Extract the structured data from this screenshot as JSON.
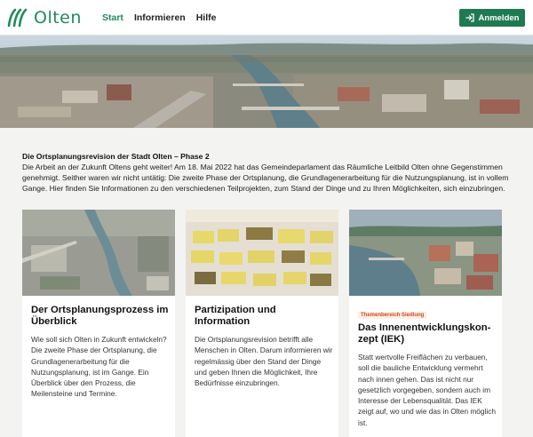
{
  "header": {
    "logo_text": "Olten",
    "nav": [
      {
        "label": "Start",
        "active": true
      },
      {
        "label": "Informieren",
        "active": false
      },
      {
        "label": "Hilfe",
        "active": false
      }
    ],
    "login_label": "Anmelden"
  },
  "intro": {
    "title": "Die Ortsplanungsrevision der Stadt Olten – Phase 2",
    "text": "Die Arbeit an der Zukunft Oltens geht weiter! Am 18. Mai 2022 hat das Gemeindeparlament das Räumliche Leitbild Olten ohne Gegenstimmen genehmigt. Seither waren wir nicht untätig: Die zweite Phase der Ortsplanung, die Grundlagenerarbeitung für die Nutzungsplanung, ist in vollem Gange. Hier finden Sie Informationen zu den verschiedenen Teilprojekten, zum Stand der Dinge und zu Ihren Möglichkeiten, sich einzubringen."
  },
  "cards": [
    {
      "tag": "",
      "title": "Der Ortsplanungsprozess im Überblick",
      "text": "Wie soll sich Olten in Zukunft entwickeln? Die zweite Phase der Ortsplanung, die Grundlagenerarbeitung für die Nutzungsplanung, ist im Gange. Ein Überblick über den Prozess, die Meilensteine und Termine."
    },
    {
      "tag": "",
      "title": "Partizipation und Information",
      "text": "Die Ortsplanungsrevision betrifft alle Menschen in Olten. Darum informieren wir regelmässig über den Stand der Dinge und geben Ihnen die Möglichkeit, Ihre Bedürfnisse einzubringen."
    },
    {
      "tag": "Themenbereich Siedlung",
      "title": "Das Innenentwicklungskon­zept (IEK)",
      "text": "Statt wertvolle Freiflächen zu verbauen, soll die bauliche Entwicklung vermehrt nach innen gehen. Das ist nicht nur gesetzlich vorgegeben, sondern auch im Interesse der Lebensqualität. Das IEK zeigt auf, wo und wie das in Olten möglich ist."
    }
  ],
  "colors": {
    "brand_green": "#1f8a5c",
    "button_green": "#1f7a52",
    "tag_orange": "#d04a1a"
  },
  "icons": {
    "logo": "olten-waves-logo",
    "login": "login-arrow-icon"
  }
}
